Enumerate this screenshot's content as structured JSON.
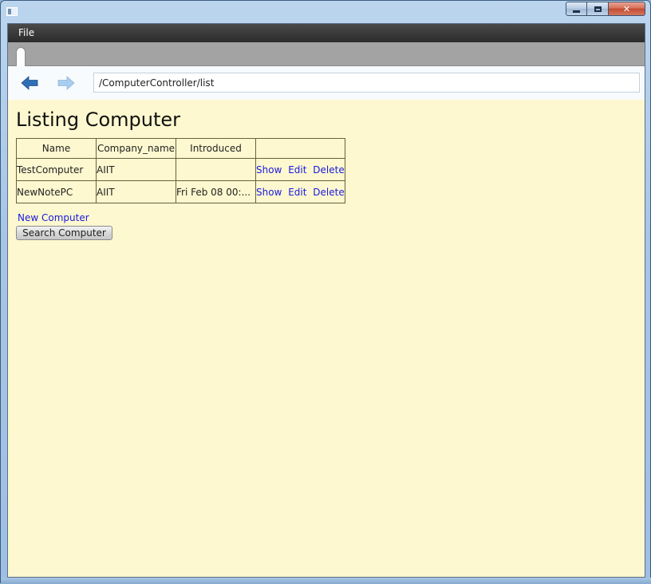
{
  "window": {
    "controls": {
      "minimize": "",
      "maximize": "",
      "close": "✕"
    }
  },
  "menu": {
    "file": "File"
  },
  "nav": {
    "address": "/ComputerController/list"
  },
  "page": {
    "title": "Listing Computer",
    "columns": [
      "Name",
      "Company_name",
      "Introduced",
      ""
    ],
    "rows": [
      {
        "name": "TestComputer",
        "company": "AIIT",
        "introduced": "",
        "show": "Show",
        "edit": "Edit",
        "delete": "Delete"
      },
      {
        "name": "NewNotePC",
        "company": "AIIT",
        "introduced": "Fri Feb 08 00:...",
        "show": "Show",
        "edit": "Edit",
        "delete": "Delete"
      }
    ],
    "new_link": "New Computer",
    "search_button": "Search Computer"
  },
  "icons": {
    "back": "arrow-left-icon",
    "forward": "arrow-right-icon"
  },
  "colors": {
    "content_bg": "#fdf8cf",
    "link": "#1a1ae0",
    "back_arrow": "#2f6fb6",
    "forward_arrow": "#9cc2e6"
  }
}
